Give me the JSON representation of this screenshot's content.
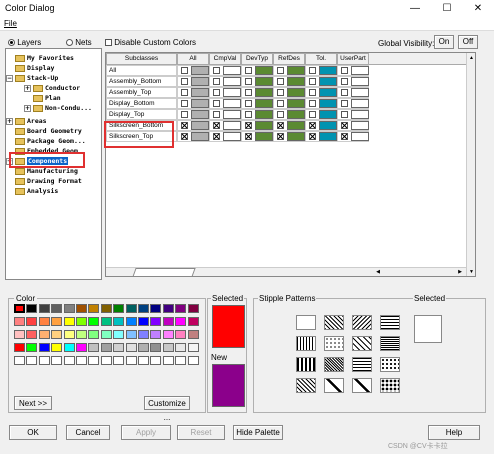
{
  "window": {
    "title": "Color Dialog",
    "minimize": "—",
    "maximize": "☐",
    "close": "✕"
  },
  "menu": {
    "file": "File"
  },
  "options": {
    "layers": "Layers",
    "nets": "Nets",
    "disable_custom": "Disable Custom Colors",
    "global_visibility": "Global Visibility:",
    "on": "On",
    "off": "Off"
  },
  "tree": [
    {
      "label": "My Favorites",
      "exp": ""
    },
    {
      "label": "Display",
      "exp": ""
    },
    {
      "label": "Stack-Up",
      "exp": "−"
    },
    {
      "label": "Conductor",
      "exp": "+"
    },
    {
      "label": "Plan",
      "exp": ""
    },
    {
      "label": "Non-Condu...",
      "exp": "+"
    },
    {
      "label": "Areas",
      "exp": "+"
    },
    {
      "label": "Board Geometry",
      "exp": ""
    },
    {
      "label": "Package Geom...",
      "exp": ""
    },
    {
      "label": "Embedded Geom",
      "exp": ""
    },
    {
      "label": "Components",
      "exp": "+"
    },
    {
      "label": "Manufacturing",
      "exp": ""
    },
    {
      "label": "Drawing Format",
      "exp": ""
    },
    {
      "label": "Analysis",
      "exp": ""
    }
  ],
  "grid": {
    "headers": [
      "Subclasses",
      "All",
      "CmpVal",
      "DevTyp",
      "RefDes",
      "Tol.",
      "UserPart"
    ],
    "rows": [
      "All",
      "Assembly_Bottom",
      "Assembly_Top",
      "Display_Bottom",
      "Display_Top",
      "Silkscreen_Bottom",
      "Silkscreen_Top"
    ],
    "column_colors": [
      "#b0b0b0",
      "#ffffff",
      "#5b8a32",
      "#5b8a32",
      "#0093b0",
      "#ffffff",
      "#5b8a32"
    ]
  },
  "palette": {
    "label": "Color",
    "colors": [
      "#ff0000",
      "#000000",
      "#404040",
      "#606060",
      "#808080",
      "#a05000",
      "#c08000",
      "#806000",
      "#008000",
      "#006060",
      "#004080",
      "#000080",
      "#400080",
      "#800080",
      "#800040",
      "#ff8080",
      "#ff4040",
      "#ff8040",
      "#ffa040",
      "#ffff00",
      "#80ff00",
      "#00ff00",
      "#00c080",
      "#00c0c0",
      "#0080ff",
      "#0000ff",
      "#8000ff",
      "#c000c0",
      "#ff00ff",
      "#c00060",
      "#ffc0c0",
      "#ff6060",
      "#ffb070",
      "#ffd080",
      "#ffff80",
      "#c0ff80",
      "#80ff80",
      "#80ffc0",
      "#80ffff",
      "#80c0ff",
      "#8080ff",
      "#c080ff",
      "#ff80ff",
      "#ff80c0",
      "#c08080",
      "#ff0000",
      "#00ff00",
      "#0000ff",
      "#ffff00",
      "#00ffff",
      "#ff00ff",
      "#c0c0c0",
      "#a0a0a0",
      "#d0d0d0",
      "#e0e0e0",
      "#b0b0b0",
      "#909090",
      "#c8c8c8",
      "#e8e8e8",
      "#f4f4f4",
      "#ffffff",
      "#ffffff",
      "#ffffff",
      "#ffffff",
      "#ffffff",
      "#ffffff",
      "#ffffff",
      "#ffffff",
      "#ffffff",
      "#ffffff",
      "#ffffff",
      "#ffffff",
      "#ffffff",
      "#ffffff",
      "#ffffff"
    ],
    "next": "Next >>",
    "customize": "Customize ..."
  },
  "selected": {
    "label": "Selected",
    "color": "#ff0000"
  },
  "new": {
    "label": "New",
    "color": "#8b008b"
  },
  "stipple": {
    "label": "Stipple Patterns",
    "selected_label": "Selected"
  },
  "buttons": {
    "ok": "OK",
    "cancel": "Cancel",
    "apply": "Apply",
    "reset": "Reset",
    "hide_palette": "Hide Palette",
    "help": "Help"
  },
  "watermark": "CSDN @CV卡卡拉"
}
